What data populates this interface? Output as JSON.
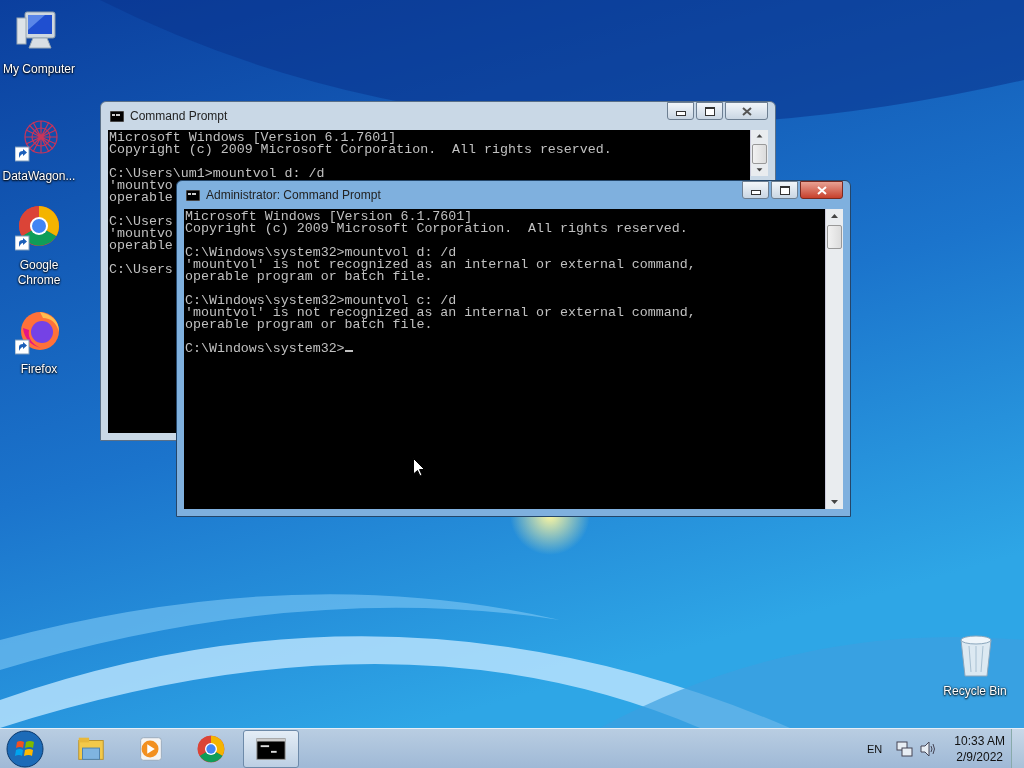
{
  "desktop": {
    "icons": [
      {
        "kind": "computer",
        "label": "My Computer",
        "shortcut": false
      },
      {
        "kind": "datawagon",
        "label": "DataWagon...",
        "shortcut": true
      },
      {
        "kind": "chrome",
        "label": "Google Chrome",
        "shortcut": true
      },
      {
        "kind": "firefox",
        "label": "Firefox",
        "shortcut": true
      },
      {
        "kind": "recycle",
        "label": "Recycle Bin",
        "shortcut": false
      }
    ]
  },
  "windows": [
    {
      "title": "Command Prompt",
      "active": false,
      "cursor": false,
      "blocks": [
        [
          "Microsoft Windows [Version 6.1.7601]",
          "Copyright (c) 2009 Microsoft Corporation.  All rights reserved."
        ],
        [
          "C:\\Users\\um1>mountvol d: /d",
          "'mountvo",
          "operable"
        ],
        [
          "C:\\Users",
          "'mountvo",
          "operable"
        ],
        [
          "C:\\Users"
        ]
      ]
    },
    {
      "title": "Administrator: Command Prompt",
      "active": true,
      "cursor": true,
      "blocks": [
        [
          "Microsoft Windows [Version 6.1.7601]",
          "Copyright (c) 2009 Microsoft Corporation.  All rights reserved."
        ],
        [
          "C:\\Windows\\system32>mountvol d: /d",
          "'mountvol' is not recognized as an internal or external command,",
          "operable program or batch file."
        ],
        [
          "C:\\Windows\\system32>mountvol c: /d",
          "'mountvol' is not recognized as an internal or external command,",
          "operable program or batch file."
        ],
        [
          "C:\\Windows\\system32>"
        ]
      ]
    }
  ],
  "taskbar": {
    "items": [
      {
        "kind": "explorer",
        "selected": false
      },
      {
        "kind": "media",
        "selected": false
      },
      {
        "kind": "chrome",
        "selected": false
      },
      {
        "kind": "cmd",
        "selected": true
      }
    ],
    "language": "EN",
    "time": "10:33 AM",
    "date": "2/9/2022"
  }
}
